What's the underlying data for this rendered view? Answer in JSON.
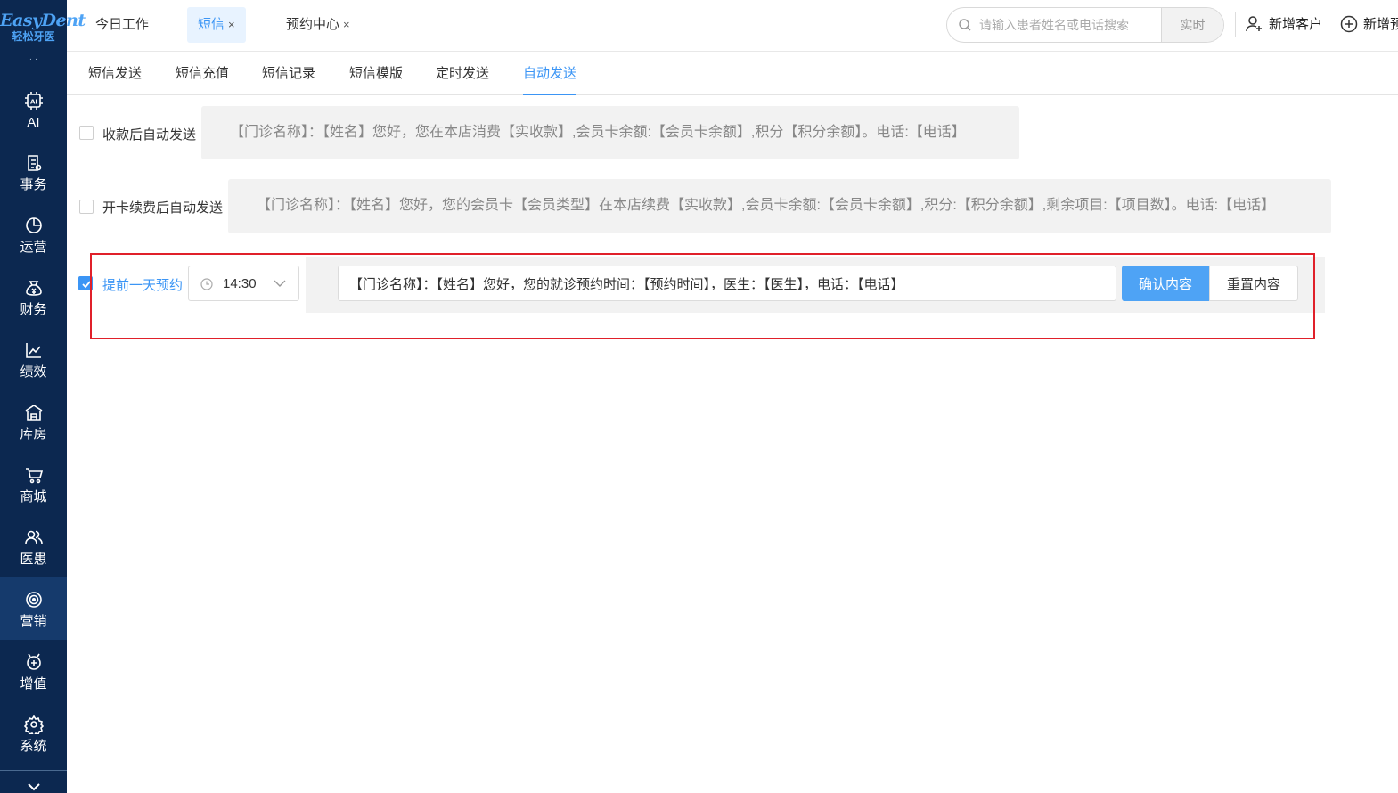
{
  "brand": {
    "name": "EasyDent",
    "subtitle": "轻松牙医"
  },
  "sidebar": {
    "more": "· ·",
    "items": [
      {
        "label": "AI",
        "icon": "ai-icon"
      },
      {
        "label": "事务",
        "icon": "clipboard-icon"
      },
      {
        "label": "运营",
        "icon": "pie-chart-icon"
      },
      {
        "label": "财务",
        "icon": "money-bag-icon"
      },
      {
        "label": "绩效",
        "icon": "line-chart-icon"
      },
      {
        "label": "库房",
        "icon": "warehouse-icon"
      },
      {
        "label": "商城",
        "icon": "cart-icon"
      },
      {
        "label": "医患",
        "icon": "users-icon"
      },
      {
        "label": "营销",
        "icon": "target-icon",
        "active": true
      },
      {
        "label": "增值",
        "icon": "value-add-icon"
      },
      {
        "label": "系统",
        "icon": "gear-icon"
      }
    ],
    "collapse_icon": "chevron-down-icon"
  },
  "header": {
    "tabs": [
      {
        "label": "今日工作",
        "closable": false
      },
      {
        "label": "短信",
        "closable": true,
        "active": true
      },
      {
        "label": "预约中心",
        "closable": true
      }
    ],
    "close_glyph": "×",
    "search": {
      "placeholder": "请输入患者姓名或电话搜索",
      "value": "",
      "button": "实时"
    },
    "actions": [
      "新增客户",
      "新增预"
    ]
  },
  "subtabs": [
    {
      "label": "短信发送"
    },
    {
      "label": "短信充值"
    },
    {
      "label": "短信记录"
    },
    {
      "label": "短信模版"
    },
    {
      "label": "定时发送"
    },
    {
      "label": "自动发送",
      "active": true
    }
  ],
  "rules": {
    "payment": {
      "checked": false,
      "label": "收款后自动发送",
      "template": "【门诊名称】：【姓名】您好，您在本店消费【实收款】,会员卡余额:【会员卡余额】,积分【积分余额】。电话:【电话】"
    },
    "card_renewal": {
      "checked": false,
      "label": "开卡续费后自动发送",
      "template": "【门诊名称】：【姓名】您好，您的会员卡【会员类型】在本店续费【实收款】,会员卡余额:【会员卡余额】,积分:【积分余额】,剩余项目:【项目数】。电话:【电话】"
    },
    "appointment_reminder": {
      "checked": true,
      "label": "提前一天预约",
      "time": "14:30",
      "template": "【门诊名称】：【姓名】您好，您的就诊预约时间：【预约时间】，医生：【医生】，电话：【电话】",
      "confirm_button": "确认内容",
      "reset_button": "重置内容"
    }
  },
  "colors": {
    "sidebar_bg": "#0c2850",
    "accent": "#3b95f5",
    "highlight": "#e0202a"
  }
}
